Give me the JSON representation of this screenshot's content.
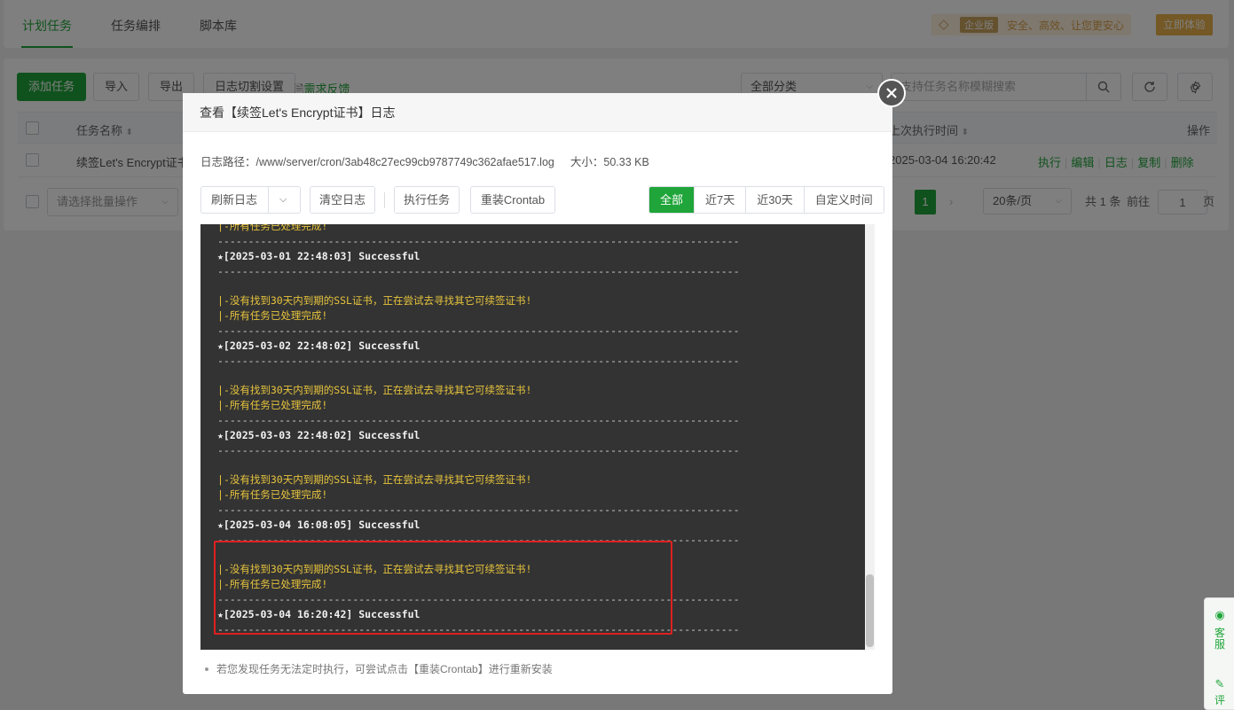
{
  "top_tabs": [
    "计划任务",
    "任务编排",
    "脚本库"
  ],
  "promo": {
    "edition": "企业版",
    "slogan": "安全、高效、让您更安心",
    "try_label": "立即体验"
  },
  "toolbar": {
    "add_label": "添加任务",
    "import_label": "导入",
    "export_label": "导出",
    "log_split_label": "日志切割设置",
    "feedback_label": "需求反馈",
    "category_value": "全部分类",
    "search_placeholder": "支持任务名称模糊搜索"
  },
  "table": {
    "headers": {
      "name": "任务名称",
      "last_run": "上次执行时间",
      "ops": "操作"
    },
    "rows": [
      {
        "name": "续签Let's Encrypt证书",
        "last_run": "2025-03-04 16:20:42"
      }
    ],
    "ops": [
      "执行",
      "编辑",
      "日志",
      "复制",
      "删除"
    ]
  },
  "footer": {
    "batch_placeholder": "请选择批量操作",
    "current_page": "1",
    "page_size": "20条/页",
    "total": "共 1 条",
    "goto_label": "前往",
    "goto_value": "1",
    "page_suffix": "页"
  },
  "modal": {
    "title": "查看【续签Let's Encrypt证书】日志",
    "path_label": "日志路径：/www/server/cron/3ab48c27ec99cb9787749c362afae517.log",
    "size_label": "大小：",
    "size_value": "50.33 KB",
    "buttons": {
      "refresh": "刷新日志",
      "clear": "清空日志",
      "run": "执行任务",
      "reinstall": "重装Crontab"
    },
    "ranges": [
      "全部",
      "近7天",
      "近30天",
      "自定义时间"
    ],
    "note": "若您发现任务无法定时执行，可尝试点击【重装Crontab】进行重新安装",
    "log_lines": [
      {
        "type": "bar",
        "text": "-所有任务已处理完成!"
      },
      {
        "type": "dash",
        "text": "-------------------------------------------------------------------------------------"
      },
      {
        "type": "succ",
        "text": "★[2025-03-01 22:48:03] Successful"
      },
      {
        "type": "dash",
        "text": "-------------------------------------------------------------------------------------"
      },
      {
        "type": "blank",
        "text": ""
      },
      {
        "type": "bar",
        "text": "-没有找到30天内到期的SSL证书，正在尝试去寻找其它可续签证书!"
      },
      {
        "type": "bar",
        "text": "-所有任务已处理完成!"
      },
      {
        "type": "dash",
        "text": "-------------------------------------------------------------------------------------"
      },
      {
        "type": "succ",
        "text": "★[2025-03-02 22:48:02] Successful"
      },
      {
        "type": "dash",
        "text": "-------------------------------------------------------------------------------------"
      },
      {
        "type": "blank",
        "text": ""
      },
      {
        "type": "bar",
        "text": "-没有找到30天内到期的SSL证书，正在尝试去寻找其它可续签证书!"
      },
      {
        "type": "bar",
        "text": "-所有任务已处理完成!"
      },
      {
        "type": "dash",
        "text": "-------------------------------------------------------------------------------------"
      },
      {
        "type": "succ",
        "text": "★[2025-03-03 22:48:02] Successful"
      },
      {
        "type": "dash",
        "text": "-------------------------------------------------------------------------------------"
      },
      {
        "type": "blank",
        "text": ""
      },
      {
        "type": "bar",
        "text": "-没有找到30天内到期的SSL证书，正在尝试去寻找其它可续签证书!"
      },
      {
        "type": "bar",
        "text": "-所有任务已处理完成!"
      },
      {
        "type": "dash",
        "text": "-------------------------------------------------------------------------------------"
      },
      {
        "type": "succ",
        "text": "★[2025-03-04 16:08:05] Successful"
      },
      {
        "type": "dash",
        "text": "-------------------------------------------------------------------------------------"
      },
      {
        "type": "blank",
        "text": ""
      },
      {
        "type": "bar",
        "text": "-没有找到30天内到期的SSL证书，正在尝试去寻找其它可续签证书!"
      },
      {
        "type": "bar",
        "text": "-所有任务已处理完成!"
      },
      {
        "type": "dash",
        "text": "-------------------------------------------------------------------------------------"
      },
      {
        "type": "succ",
        "text": "★[2025-03-04 16:20:42] Successful"
      },
      {
        "type": "dash",
        "text": "-------------------------------------------------------------------------------------"
      }
    ]
  },
  "side_float": {
    "service": "客服",
    "review": "评"
  },
  "colors": {
    "accent": "#20a53a",
    "highlight": "#e02020",
    "console_bg": "#333333"
  }
}
